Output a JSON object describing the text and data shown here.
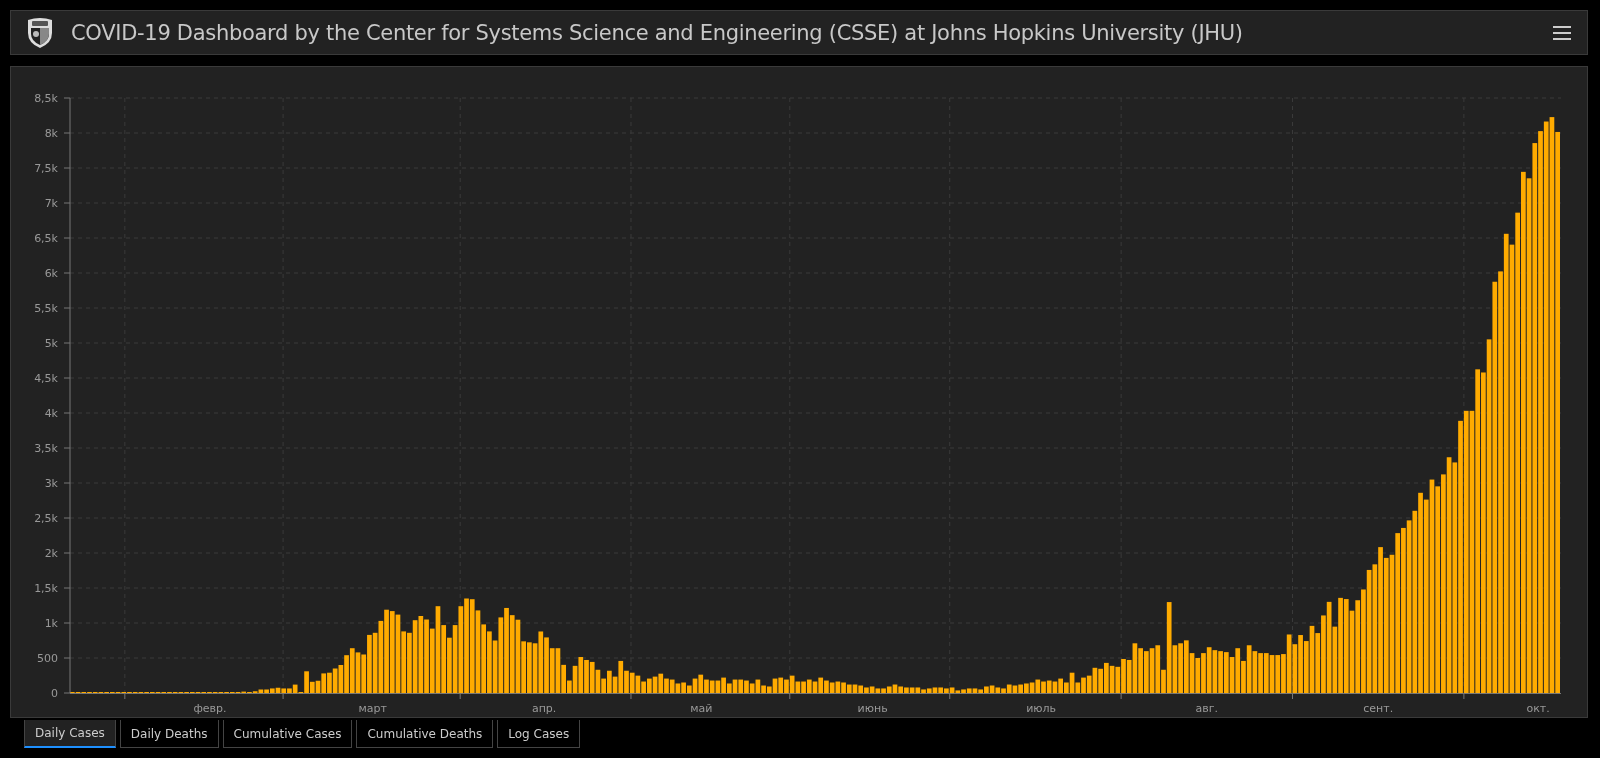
{
  "header": {
    "title": "COVID-19 Dashboard by the Center for Systems Science and Engineering (CSSE) at Johns Hopkins University (JHU)"
  },
  "chart": {
    "month_labels": [
      "февр.",
      "март",
      "апр.",
      "май",
      "июнь",
      "июль",
      "авг.",
      "сент.",
      "окт."
    ],
    "chart_data": {
      "type": "bar",
      "color": "#ffab00",
      "grid": true,
      "ylim": [
        0,
        8500
      ],
      "yticks": [
        {
          "value": 0,
          "label": "0"
        },
        {
          "value": 500,
          "label": "500"
        },
        {
          "value": 1000,
          "label": "1k"
        },
        {
          "value": 1500,
          "label": "1,5k"
        },
        {
          "value": 2000,
          "label": "2k"
        },
        {
          "value": 2500,
          "label": "2,5k"
        },
        {
          "value": 3000,
          "label": "3k"
        },
        {
          "value": 3500,
          "label": "3,5k"
        },
        {
          "value": 4000,
          "label": "4k"
        },
        {
          "value": 4500,
          "label": "4,5k"
        },
        {
          "value": 5000,
          "label": "5k"
        },
        {
          "value": 5500,
          "label": "5,5k"
        },
        {
          "value": 6000,
          "label": "6k"
        },
        {
          "value": 6500,
          "label": "6,5k"
        },
        {
          "value": 7000,
          "label": "7k"
        },
        {
          "value": 7500,
          "label": "7,5k"
        },
        {
          "value": 8000,
          "label": "8k"
        },
        {
          "value": 8500,
          "label": "8,5k"
        }
      ],
      "values": [
        0,
        0,
        0,
        0,
        0,
        0,
        0,
        0,
        0,
        0,
        0,
        0,
        0,
        0,
        0,
        0,
        0,
        0,
        0,
        0,
        0,
        0,
        0,
        0,
        0,
        0,
        0,
        0,
        0,
        0,
        20,
        10,
        25,
        50,
        50,
        65,
        75,
        65,
        65,
        120,
        10,
        310,
        160,
        175,
        280,
        290,
        350,
        400,
        540,
        640,
        580,
        550,
        830,
        860,
        1030,
        1190,
        1170,
        1120,
        880,
        860,
        1040,
        1100,
        1050,
        920,
        1240,
        970,
        790,
        970,
        1240,
        1350,
        1340,
        1180,
        980,
        880,
        750,
        1080,
        1215,
        1112,
        1047,
        738,
        724,
        710,
        879,
        794,
        640,
        640,
        402,
        178,
        388,
        514,
        472,
        444,
        332,
        206,
        318,
        234,
        458,
        318,
        290,
        248,
        164,
        206,
        234,
        276,
        206,
        192,
        136,
        150,
        107,
        206,
        262,
        192,
        178,
        178,
        220,
        136,
        192,
        192,
        178,
        136,
        192,
        107,
        93,
        206,
        220,
        192,
        248,
        164,
        164,
        192,
        164,
        220,
        178,
        150,
        164,
        150,
        121,
        121,
        107,
        79,
        93,
        65,
        65,
        93,
        121,
        93,
        79,
        79,
        79,
        51,
        65,
        79,
        79,
        65,
        79,
        37,
        51,
        65,
        65,
        51,
        93,
        107,
        79,
        65,
        121,
        107,
        121,
        136,
        150,
        192,
        164,
        178,
        164,
        206,
        150,
        290,
        150,
        220,
        248,
        360,
        346,
        430,
        388,
        374,
        486,
        472,
        710,
        640,
        598,
        640,
        682,
        332,
        1299,
        682,
        710,
        752,
        570,
        500,
        570,
        654,
        612,
        598,
        584,
        514,
        640,
        458,
        682,
        598,
        570,
        570,
        542,
        542,
        556,
        836,
        697,
        828,
        742,
        959,
        856,
        1108,
        1302,
        948,
        1359,
        1342,
        1176,
        1325,
        1479,
        1758,
        1838,
        2084,
        1930,
        1975,
        2284,
        2358,
        2466,
        2603,
        2860,
        2763,
        3049,
        2952,
        3123,
        3368,
        3294,
        3888,
        4031,
        4031,
        4624,
        4579,
        5052,
        5875,
        6023,
        6560,
        6405,
        6862,
        7445,
        7353,
        7856,
        8027,
        8164,
        8227,
        8015
      ]
    }
  },
  "tabs": [
    {
      "label": "Daily Cases",
      "selected": true
    },
    {
      "label": "Daily Deaths",
      "selected": false
    },
    {
      "label": "Cumulative Cases",
      "selected": false
    },
    {
      "label": "Cumulative Deaths",
      "selected": false
    },
    {
      "label": "Log Cases",
      "selected": false
    }
  ]
}
